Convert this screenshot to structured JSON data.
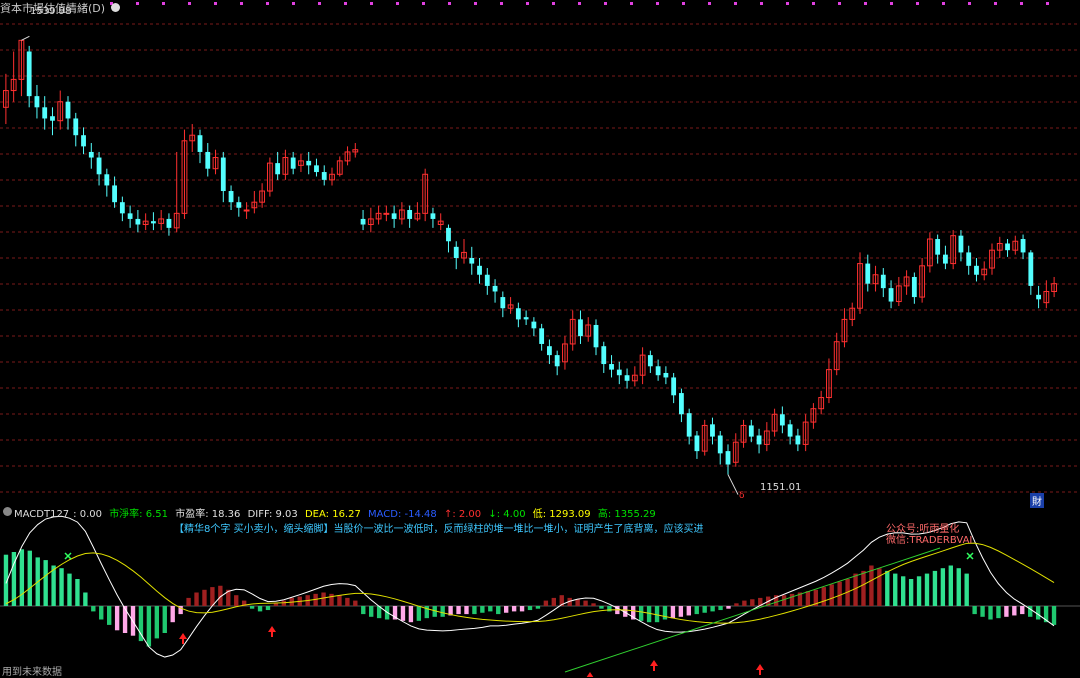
{
  "header": {
    "title": "資本市場估值情緒(D)",
    "gear_icon": "gear-icon",
    "high_label": "1539.98"
  },
  "main_chart": {
    "low_label": "1151.01",
    "low_marker": "δ",
    "earnings_badge": "財"
  },
  "indicator_bar": {
    "name": "MACDT127",
    "value": ": 0.00",
    "items": [
      {
        "label": "市淨率: 6.51",
        "color": "#00e000"
      },
      {
        "label": "市盈率: 18.36",
        "color": "#e0e0e0"
      },
      {
        "label": "DIFF: 9.03",
        "color": "#e0e0e0"
      },
      {
        "label": "DEA: 16.27",
        "color": "#ffff00"
      },
      {
        "label": "MACD: -14.48",
        "color": "#2a5cff"
      },
      {
        "label": "↑: 2.00",
        "color": "#ff3030"
      },
      {
        "label": "↓: 4.00",
        "color": "#00e000"
      },
      {
        "label": "低: 1293.09",
        "color": "#ffff00"
      },
      {
        "label": "高: 1355.29",
        "color": "#00e000"
      }
    ]
  },
  "note_text": "【精华8个字 买小卖小，缩头缩脚】当股价一波比一波低时，反而绿柱的堆一堆比一堆小，证明产生了底背离，应该买进",
  "brand": {
    "line1": "公众号:听雨量化",
    "line2": "微信:TRADERBVAI"
  },
  "footer_text": "用到未来数据",
  "colors": {
    "bg": "#000000",
    "up": "#ff3030",
    "down": "#54ffff",
    "grid": "#7a1a1a",
    "macd_pos": "#a02020",
    "macd_neg_light": "#ffa8e8",
    "macd_neg_dark": "#20c870",
    "macd_pos_green": "#30e090",
    "zone": "#b8a0a0",
    "diff": "#ffffff",
    "dea": "#e0e000"
  },
  "chart_data": {
    "type": "candlestick",
    "ylim": [
      1130,
      1560
    ],
    "high_annotation": 1539.98,
    "low_annotation": 1151.01,
    "candles": [
      [
        1480,
        1495,
        1510,
        1465
      ],
      [
        1495,
        1505,
        1530,
        1485
      ],
      [
        1505,
        1539.98,
        1539.98,
        1490
      ],
      [
        1530,
        1490,
        1535,
        1480
      ],
      [
        1490,
        1480,
        1500,
        1470
      ],
      [
        1480,
        1470,
        1490,
        1460
      ],
      [
        1472,
        1468,
        1480,
        1455
      ],
      [
        1468,
        1485,
        1495,
        1460
      ],
      [
        1485,
        1470,
        1490,
        1460
      ],
      [
        1470,
        1455,
        1475,
        1445
      ],
      [
        1455,
        1445,
        1462,
        1438
      ],
      [
        1440,
        1435,
        1448,
        1425
      ],
      [
        1435,
        1420,
        1440,
        1410
      ],
      [
        1420,
        1410,
        1425,
        1400
      ],
      [
        1410,
        1395,
        1418,
        1390
      ],
      [
        1395,
        1385,
        1400,
        1378
      ],
      [
        1385,
        1380,
        1392,
        1372
      ],
      [
        1380,
        1375,
        1388,
        1368
      ],
      [
        1375,
        1378,
        1385,
        1370
      ],
      [
        1378,
        1376,
        1386,
        1370
      ],
      [
        1376,
        1380,
        1388,
        1370
      ],
      [
        1380,
        1372,
        1385,
        1365
      ],
      [
        1372,
        1385,
        1440,
        1368
      ],
      [
        1385,
        1450,
        1460,
        1380
      ],
      [
        1450,
        1455,
        1465,
        1440
      ],
      [
        1455,
        1440,
        1460,
        1430
      ],
      [
        1440,
        1425,
        1448,
        1418
      ],
      [
        1425,
        1435,
        1442,
        1420
      ],
      [
        1435,
        1405,
        1440,
        1395
      ],
      [
        1405,
        1395,
        1410,
        1388
      ],
      [
        1395,
        1390,
        1400,
        1382
      ],
      [
        1388,
        1388,
        1395,
        1380
      ],
      [
        1390,
        1395,
        1405,
        1385
      ],
      [
        1395,
        1405,
        1412,
        1390
      ],
      [
        1405,
        1430,
        1435,
        1400
      ],
      [
        1430,
        1420,
        1440,
        1415
      ],
      [
        1420,
        1435,
        1442,
        1415
      ],
      [
        1435,
        1425,
        1440,
        1420
      ],
      [
        1428,
        1432,
        1438,
        1422
      ],
      [
        1432,
        1428,
        1440,
        1420
      ],
      [
        1428,
        1422,
        1434,
        1418
      ],
      [
        1422,
        1415,
        1428,
        1410
      ],
      [
        1415,
        1420,
        1426,
        1410
      ],
      [
        1420,
        1432,
        1436,
        1418
      ],
      [
        1432,
        1440,
        1445,
        1428
      ],
      [
        1440,
        1442,
        1448,
        1435
      ],
      [
        1380,
        1375,
        1388,
        1370
      ],
      [
        1375,
        1380,
        1390,
        1368
      ],
      [
        1380,
        1385,
        1392,
        1375
      ],
      [
        1385,
        1385,
        1392,
        1378
      ],
      [
        1385,
        1380,
        1392,
        1372
      ],
      [
        1380,
        1388,
        1395,
        1375
      ],
      [
        1388,
        1380,
        1392,
        1372
      ],
      [
        1380,
        1385,
        1395,
        1378
      ],
      [
        1385,
        1420,
        1425,
        1378
      ],
      [
        1385,
        1380,
        1390,
        1372
      ],
      [
        1375,
        1378,
        1385,
        1370
      ],
      [
        1372,
        1360,
        1375,
        1350
      ],
      [
        1355,
        1345,
        1360,
        1335
      ],
      [
        1345,
        1350,
        1362,
        1340
      ],
      [
        1345,
        1340,
        1355,
        1330
      ],
      [
        1338,
        1330,
        1345,
        1322
      ],
      [
        1330,
        1320,
        1336,
        1312
      ],
      [
        1320,
        1315,
        1326,
        1305
      ],
      [
        1310,
        1300,
        1315,
        1292
      ],
      [
        1300,
        1303,
        1310,
        1295
      ],
      [
        1300,
        1290,
        1305,
        1283
      ],
      [
        1292,
        1290,
        1298,
        1285
      ],
      [
        1288,
        1282,
        1292,
        1275
      ],
      [
        1282,
        1268,
        1286,
        1262
      ],
      [
        1266,
        1258,
        1272,
        1250
      ],
      [
        1258,
        1248,
        1262,
        1240
      ],
      [
        1252,
        1268,
        1275,
        1245
      ],
      [
        1268,
        1290,
        1298,
        1262
      ],
      [
        1290,
        1275,
        1298,
        1268
      ],
      [
        1275,
        1285,
        1292,
        1270
      ],
      [
        1285,
        1265,
        1290,
        1258
      ],
      [
        1266,
        1250,
        1270,
        1242
      ],
      [
        1250,
        1245,
        1258,
        1238
      ],
      [
        1245,
        1240,
        1252,
        1232
      ],
      [
        1240,
        1235,
        1246,
        1228
      ],
      [
        1235,
        1240,
        1248,
        1230
      ],
      [
        1240,
        1258,
        1265,
        1232
      ],
      [
        1258,
        1248,
        1262,
        1242
      ],
      [
        1248,
        1240,
        1254,
        1235
      ],
      [
        1242,
        1238,
        1248,
        1232
      ],
      [
        1238,
        1222,
        1242,
        1215
      ],
      [
        1224,
        1205,
        1228,
        1198
      ],
      [
        1206,
        1185,
        1210,
        1178
      ],
      [
        1186,
        1172,
        1190,
        1165
      ],
      [
        1172,
        1195,
        1200,
        1168
      ],
      [
        1196,
        1185,
        1202,
        1178
      ],
      [
        1186,
        1170,
        1190,
        1160
      ],
      [
        1172,
        1160,
        1178,
        1151.01
      ],
      [
        1162,
        1180,
        1188,
        1158
      ],
      [
        1180,
        1195,
        1200,
        1175
      ],
      [
        1195,
        1185,
        1200,
        1180
      ],
      [
        1186,
        1178,
        1192,
        1170
      ],
      [
        1178,
        1190,
        1198,
        1172
      ],
      [
        1190,
        1205,
        1210,
        1185
      ],
      [
        1205,
        1195,
        1212,
        1188
      ],
      [
        1196,
        1185,
        1200,
        1178
      ],
      [
        1186,
        1178,
        1192,
        1172
      ],
      [
        1178,
        1198,
        1205,
        1172
      ],
      [
        1198,
        1210,
        1215,
        1192
      ],
      [
        1210,
        1220,
        1226,
        1205
      ],
      [
        1220,
        1245,
        1255,
        1215
      ],
      [
        1245,
        1270,
        1278,
        1240
      ],
      [
        1270,
        1290,
        1300,
        1265
      ],
      [
        1290,
        1300,
        1305,
        1284
      ],
      [
        1300,
        1340,
        1350,
        1295
      ],
      [
        1340,
        1322,
        1348,
        1315
      ],
      [
        1322,
        1330,
        1338,
        1315
      ],
      [
        1330,
        1318,
        1336,
        1310
      ],
      [
        1318,
        1306,
        1325,
        1300
      ],
      [
        1306,
        1320,
        1328,
        1302
      ],
      [
        1320,
        1328,
        1334,
        1312
      ],
      [
        1328,
        1310,
        1332,
        1304
      ],
      [
        1310,
        1338,
        1345,
        1305
      ],
      [
        1338,
        1362,
        1368,
        1332
      ],
      [
        1362,
        1348,
        1366,
        1340
      ],
      [
        1348,
        1340,
        1356,
        1335
      ],
      [
        1340,
        1365,
        1370,
        1335
      ],
      [
        1365,
        1350,
        1370,
        1342
      ],
      [
        1350,
        1338,
        1356,
        1330
      ],
      [
        1338,
        1330,
        1345,
        1324
      ],
      [
        1330,
        1335,
        1342,
        1325
      ],
      [
        1336,
        1352,
        1358,
        1330
      ],
      [
        1352,
        1358,
        1364,
        1345
      ],
      [
        1358,
        1352,
        1362,
        1346
      ],
      [
        1352,
        1360,
        1365,
        1348
      ],
      [
        1362,
        1350,
        1366,
        1344
      ],
      [
        1350,
        1320,
        1352,
        1312
      ],
      [
        1312,
        1308,
        1320,
        1300
      ],
      [
        1305,
        1315,
        1325,
        1300
      ],
      [
        1315,
        1322,
        1328,
        1310
      ]
    ],
    "macd_hist": [
      38,
      40,
      42,
      41,
      36,
      34,
      30,
      28,
      24,
      20,
      10,
      -4,
      -10,
      -14,
      -18,
      -20,
      -22,
      -26,
      -30,
      -24,
      -20,
      -12,
      -6,
      6,
      10,
      12,
      14,
      15,
      12,
      8,
      4,
      -2,
      -4,
      -3,
      2,
      4,
      6,
      7,
      8,
      9,
      10,
      9,
      8,
      6,
      4,
      -6,
      -8,
      -9,
      -10,
      -10,
      -11,
      -12,
      -11,
      -9,
      -8,
      -8,
      -7,
      -6,
      -6,
      -6,
      -5,
      -4,
      -6,
      -5,
      -4,
      -4,
      -3,
      -2,
      4,
      6,
      8,
      6,
      5,
      4,
      2,
      -2,
      -4,
      -6,
      -8,
      -10,
      -11,
      -12,
      -12,
      -10,
      -9,
      -8,
      -7,
      -6,
      -5,
      -4,
      -3,
      -2,
      2,
      4,
      5,
      6,
      7,
      8,
      8,
      9,
      10,
      11,
      12,
      14,
      16,
      18,
      20,
      24,
      26,
      30,
      28,
      26,
      24,
      22,
      20,
      22,
      24,
      26,
      28,
      30,
      28,
      24,
      -6,
      -8,
      -10,
      -9,
      -8,
      -7,
      -6,
      -8,
      -10,
      -12,
      -14
    ]
  }
}
